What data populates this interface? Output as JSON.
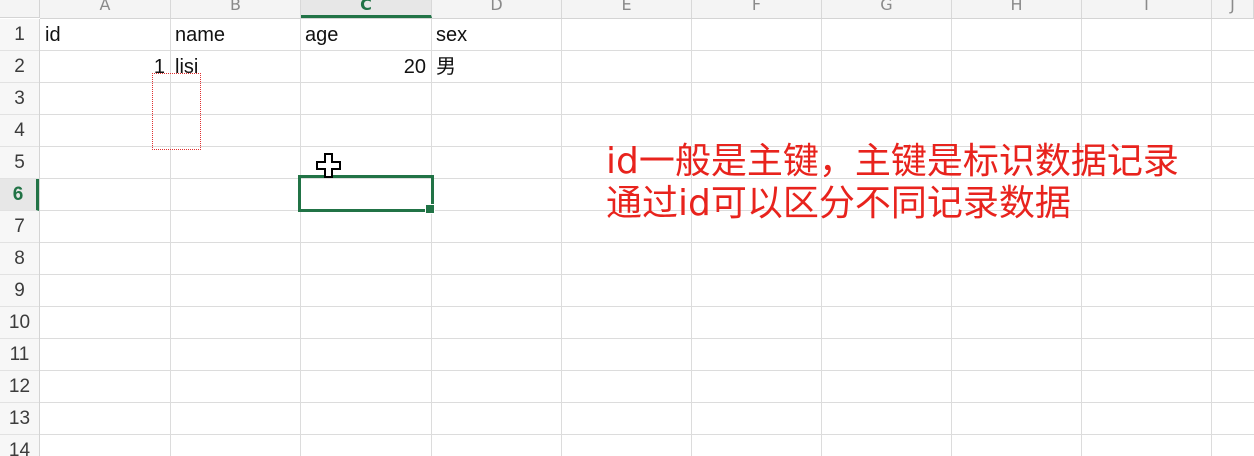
{
  "columns": [
    "A",
    "B",
    "C",
    "D",
    "E",
    "F",
    "G",
    "H",
    "I",
    "J"
  ],
  "selected_column": "C",
  "rows": [
    "1",
    "2",
    "3",
    "4",
    "5",
    "6",
    "7",
    "8",
    "9",
    "10",
    "11",
    "12",
    "13",
    "14"
  ],
  "selected_row": "6",
  "cells": {
    "A1": "id",
    "B1": "name",
    "C1": "age",
    "D1": "sex",
    "A2": "1",
    "B2": "lisi",
    "C2": "20",
    "D2": "男"
  },
  "annotation": {
    "line1": "id一般是主键，主键是标识数据记录",
    "line2": "通过id可以区分不同记录数据",
    "color": "#e8231d"
  },
  "colors": {
    "accent": "#217346",
    "gridline": "#dcdcdc"
  },
  "icons": {
    "cursor": "cross-cursor-icon"
  }
}
